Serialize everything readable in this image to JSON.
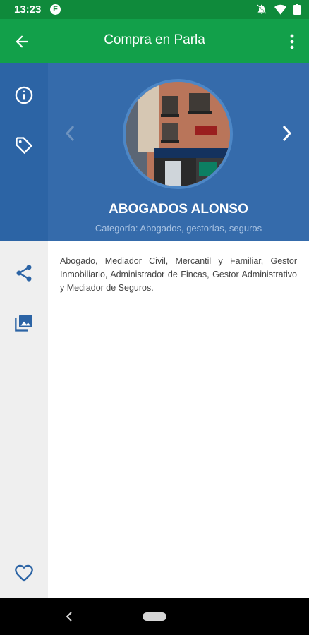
{
  "status_bar": {
    "time": "13:23",
    "app_icon_letter": "F",
    "icons": [
      "notifications-off-icon",
      "wifi-icon",
      "battery-icon"
    ]
  },
  "app_bar": {
    "title": "Compra en Parla",
    "back_icon": "arrow-back-icon",
    "menu_icon": "more-vert-icon"
  },
  "rail": {
    "top_items": [
      "info-icon",
      "tag-icon"
    ],
    "mid_items": [
      "share-icon",
      "gallery-icon"
    ],
    "bottom_items": [
      "heart-icon"
    ]
  },
  "business": {
    "name": "ABOGADOS ALONSO",
    "category": "Categoría: Abogados, gestorías, seguros",
    "description": "Abogado, Mediador Civil, Mercantil y Familiar, Gestor Inmobiliario, Administrador de Fincas, Gestor Administrativo y Mediador de Seguros."
  },
  "colors": {
    "status_bar": "#0f8a3b",
    "app_bar": "#12a04a",
    "hero": "#356bab",
    "rail_top": "#2c64a5",
    "rail_icons": "#2c64a5"
  }
}
